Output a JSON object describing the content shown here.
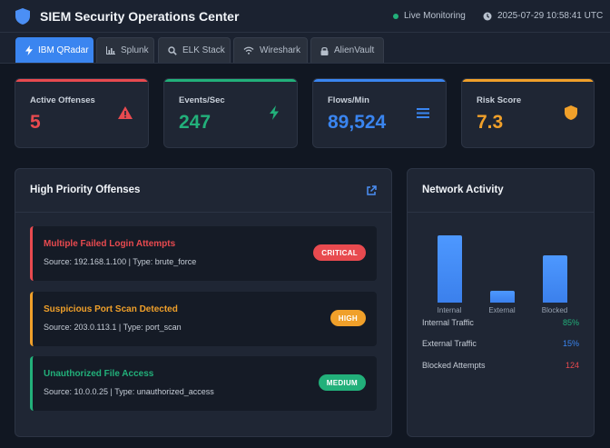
{
  "header": {
    "title": "SIEM Security Operations Center",
    "status": "Live Monitoring",
    "timestamp": "2025-07-29 10:58:41 UTC"
  },
  "tabs": [
    {
      "label": "IBM QRadar",
      "icon": "bolt-icon",
      "active": true
    },
    {
      "label": "Splunk",
      "icon": "bar-chart-icon",
      "active": false
    },
    {
      "label": "ELK Stack",
      "icon": "search-icon",
      "active": false
    },
    {
      "label": "Wireshark",
      "icon": "wifi-icon",
      "active": false
    },
    {
      "label": "AlienVault",
      "icon": "lock-icon",
      "active": false
    }
  ],
  "stats": [
    {
      "label": "Active Offenses",
      "value": "5",
      "color": "#e84a4f",
      "icon": "warning-icon"
    },
    {
      "label": "Events/Sec",
      "value": "247",
      "color": "#22b07a",
      "icon": "bolt-icon"
    },
    {
      "label": "Flows/Min",
      "value": "89,524",
      "color": "#3a85f0",
      "icon": "list-icon"
    },
    {
      "label": "Risk Score",
      "value": "7.3",
      "color": "#f0a02a",
      "icon": "shield-icon"
    }
  ],
  "offenses_panel": {
    "title": "High Priority Offenses",
    "items": [
      {
        "title": "Multiple Failed Login Attempts",
        "meta": "Source: 192.168.1.100 | Type: brute_force",
        "severity": "CRITICAL",
        "color": "#e84a4f"
      },
      {
        "title": "Suspicious Port Scan Detected",
        "meta": "Source: 203.0.113.1 | Type: port_scan",
        "severity": "HIGH",
        "color": "#f0a02a"
      },
      {
        "title": "Unauthorized File Access",
        "meta": "Source: 10.0.0.25 | Type: unauthorized_access",
        "severity": "MEDIUM",
        "color": "#22b07a"
      }
    ]
  },
  "network_panel": {
    "title": "Network Activity",
    "chart_data": {
      "type": "bar",
      "categories": [
        "Internal",
        "External",
        "Blocked"
      ],
      "values": [
        85,
        15,
        60
      ]
    },
    "metrics": [
      {
        "label": "Internal Traffic",
        "value": "85%",
        "color": "#22b07a"
      },
      {
        "label": "External Traffic",
        "value": "15%",
        "color": "#3a85f0"
      },
      {
        "label": "Blocked Attempts",
        "value": "124",
        "color": "#e84a4f"
      }
    ]
  }
}
